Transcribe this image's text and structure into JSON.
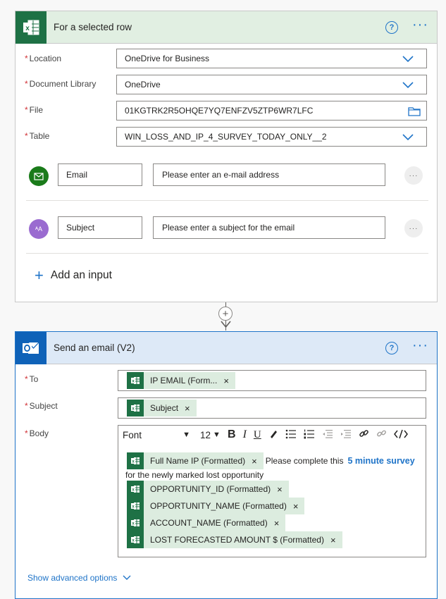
{
  "card1": {
    "title": "For a selected row",
    "help_icon": "?",
    "more_icon": "···",
    "fields": [
      {
        "label": "Location",
        "value": "OneDrive for Business"
      },
      {
        "label": "Document Library",
        "value": "OneDrive"
      },
      {
        "label": "File",
        "value": "01KGTRK2R5OHQE7YQ7ENFZV5ZTP6WR7LFC"
      },
      {
        "label": "Table",
        "value": "WIN_LOSS_AND_IP_4_SURVEY_TODAY_ONLY__2"
      }
    ],
    "inputs": [
      {
        "name": "Email",
        "placeholder": "Please enter an e-mail address",
        "icon": "mail-icon"
      },
      {
        "name": "Subject",
        "placeholder": "Please enter a subject for the email",
        "icon": "text-icon"
      }
    ],
    "add_input_label": "Add an input"
  },
  "card2": {
    "title": "Send an email (V2)",
    "to_label": "To",
    "to_token": "IP EMAIL (Form...",
    "subject_label": "Subject",
    "subject_token": "Subject",
    "body_label": "Body",
    "toolbar": {
      "font": "Font",
      "size": "12"
    },
    "body": {
      "token_fullname": "Full Name IP (Formatted)",
      "text_before_link": "Please complete this",
      "link": "5 minute survey",
      "text_after": "for the newly marked lost opportunity",
      "tokens": [
        "OPPORTUNITY_ID (Formatted)",
        "OPPORTUNITY_NAME (Formatted)",
        "ACCOUNT_NAME (Formatted)",
        "LOST FORECASTED AMOUNT $ (Formatted)"
      ]
    },
    "advanced_label": "Show advanced options"
  },
  "colors": {
    "excel_green": "#1e7145",
    "outlook_blue": "#0f62b8",
    "accent_blue": "#1f74c8",
    "required_red": "#d13438",
    "token_bg": "#dcecdf"
  }
}
